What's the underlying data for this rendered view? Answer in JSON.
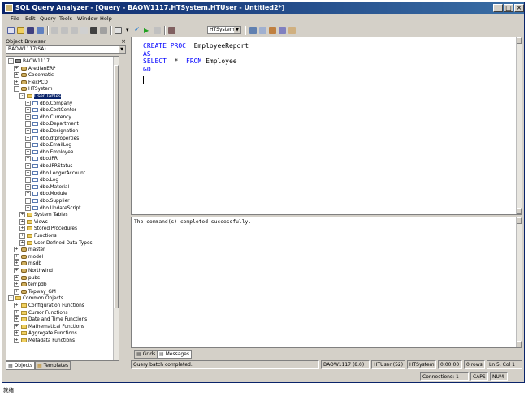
{
  "window": {
    "title": "SQL Query Analyzer - [Query - BAOW1117.HTSystem.HTUser - Untitled2*]",
    "caption_buttons": [
      "_",
      "□",
      "×"
    ]
  },
  "menu": [
    "File",
    "Edit",
    "Query",
    "Tools",
    "Window",
    "Help"
  ],
  "toolbar": {
    "database": "HTSystem"
  },
  "object_browser": {
    "title": "Object Browser",
    "close": "×",
    "server_combo": "BAOW1117(SA)",
    "tree": [
      {
        "label": "BAOW1117",
        "level": 0,
        "icon": "server",
        "exp": "-"
      },
      {
        "label": "AredianERP",
        "level": 1,
        "icon": "db",
        "exp": "+"
      },
      {
        "label": "Codematic",
        "level": 1,
        "icon": "db",
        "exp": "+"
      },
      {
        "label": "FlexPCD",
        "level": 1,
        "icon": "db",
        "exp": "+"
      },
      {
        "label": "HTSystem",
        "level": 1,
        "icon": "db",
        "exp": "-"
      },
      {
        "label": "User Tables",
        "level": 2,
        "icon": "folder",
        "exp": "-",
        "selected": true
      },
      {
        "label": "dbo.Company",
        "level": 3,
        "icon": "table",
        "exp": "+"
      },
      {
        "label": "dbo.CostCenter",
        "level": 3,
        "icon": "table",
        "exp": "+"
      },
      {
        "label": "dbo.Currency",
        "level": 3,
        "icon": "table",
        "exp": "+"
      },
      {
        "label": "dbo.Department",
        "level": 3,
        "icon": "table",
        "exp": "+"
      },
      {
        "label": "dbo.Designation",
        "level": 3,
        "icon": "table",
        "exp": "+"
      },
      {
        "label": "dbo.dtproperties",
        "level": 3,
        "icon": "table",
        "exp": "+"
      },
      {
        "label": "dbo.EmailLog",
        "level": 3,
        "icon": "table",
        "exp": "+"
      },
      {
        "label": "dbo.Employee",
        "level": 3,
        "icon": "table",
        "exp": "+"
      },
      {
        "label": "dbo.IPR",
        "level": 3,
        "icon": "table",
        "exp": "+"
      },
      {
        "label": "dbo.IPRStatus",
        "level": 3,
        "icon": "table",
        "exp": "+"
      },
      {
        "label": "dbo.LedgerAccount",
        "level": 3,
        "icon": "table",
        "exp": "+"
      },
      {
        "label": "dbo.Log",
        "level": 3,
        "icon": "table",
        "exp": "+"
      },
      {
        "label": "dbo.Material",
        "level": 3,
        "icon": "table",
        "exp": "+"
      },
      {
        "label": "dbo.Module",
        "level": 3,
        "icon": "table",
        "exp": "+"
      },
      {
        "label": "dbo.Supplier",
        "level": 3,
        "icon": "table",
        "exp": "+"
      },
      {
        "label": "dbo.UpdateScript",
        "level": 3,
        "icon": "table",
        "exp": "+"
      },
      {
        "label": "System Tables",
        "level": 2,
        "icon": "folder",
        "exp": "+"
      },
      {
        "label": "Views",
        "level": 2,
        "icon": "folder",
        "exp": "+"
      },
      {
        "label": "Stored Procedures",
        "level": 2,
        "icon": "folder",
        "exp": "+"
      },
      {
        "label": "Functions",
        "level": 2,
        "icon": "folder",
        "exp": "+"
      },
      {
        "label": "User Defined Data Types",
        "level": 2,
        "icon": "folder",
        "exp": "+"
      },
      {
        "label": "master",
        "level": 1,
        "icon": "db",
        "exp": "+"
      },
      {
        "label": "model",
        "level": 1,
        "icon": "db",
        "exp": "+"
      },
      {
        "label": "msdb",
        "level": 1,
        "icon": "db",
        "exp": "+"
      },
      {
        "label": "Northwind",
        "level": 1,
        "icon": "db",
        "exp": "+"
      },
      {
        "label": "pubs",
        "level": 1,
        "icon": "db",
        "exp": "+"
      },
      {
        "label": "tempdb",
        "level": 1,
        "icon": "db",
        "exp": "+"
      },
      {
        "label": "Topway_GM",
        "level": 1,
        "icon": "db",
        "exp": "+"
      },
      {
        "label": "Common Objects",
        "level": 0,
        "icon": "folder",
        "exp": "-"
      },
      {
        "label": "Configuration Functions",
        "level": 1,
        "icon": "folder",
        "exp": "+"
      },
      {
        "label": "Cursor Functions",
        "level": 1,
        "icon": "folder",
        "exp": "+"
      },
      {
        "label": "Date and Time Functions",
        "level": 1,
        "icon": "folder",
        "exp": "+"
      },
      {
        "label": "Mathematical Functions",
        "level": 1,
        "icon": "folder",
        "exp": "+"
      },
      {
        "label": "Aggregate Functions",
        "level": 1,
        "icon": "folder",
        "exp": "+"
      },
      {
        "label": "Metadata Functions",
        "level": 1,
        "icon": "folder",
        "exp": "+"
      }
    ],
    "tabs": [
      "Objects",
      "Templates"
    ]
  },
  "editor": {
    "lines": [
      [
        {
          "t": "CREATE PROC",
          "kw": true
        },
        {
          "t": "  EmployeeReport",
          "kw": false
        }
      ],
      [
        {
          "t": "AS",
          "kw": true
        }
      ],
      [
        {
          "t": "SELECT",
          "kw": true
        },
        {
          "t": "  *  ",
          "kw": false
        },
        {
          "t": "FROM",
          "kw": true
        },
        {
          "t": " Employee",
          "kw": false
        }
      ],
      [
        {
          "t": "GO",
          "kw": true
        }
      ]
    ]
  },
  "results": {
    "message": "The command(s) completed successfully.",
    "tabs": [
      "Grids",
      "Messages"
    ]
  },
  "query_status": {
    "message": "Query batch completed.",
    "server": "BAOW1117 (8.0)",
    "user": "HTUser (52)",
    "database": "HTSystem",
    "time": "0:00:00",
    "rows": "0 rows",
    "position": "Ln 5, Col 1"
  },
  "main_status": {
    "connections": "Connections: 1",
    "caps": "CAPS",
    "num": "NUM"
  },
  "bottom_text": "就绪",
  "colors": {
    "titlebar": "#0a246a",
    "keyword": "#0000ff",
    "selection": "#0a246a"
  }
}
